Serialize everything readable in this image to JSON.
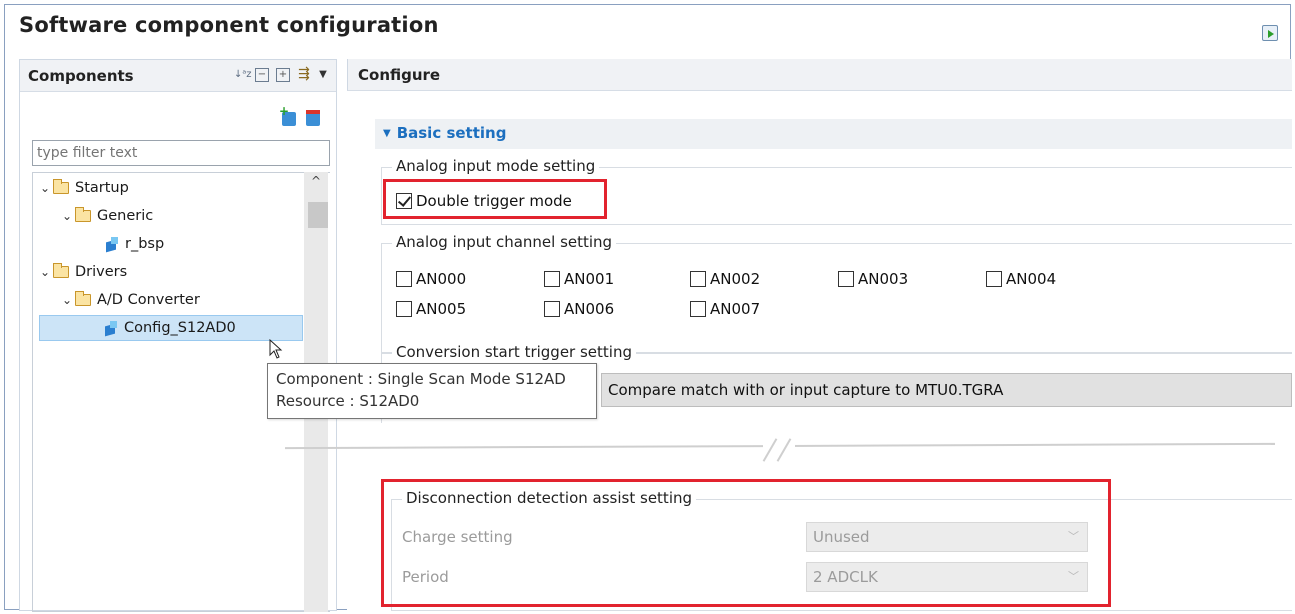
{
  "window": {
    "title": "Software component configuration"
  },
  "components_pane": {
    "title": "Components",
    "filter": {
      "placeholder": "type filter text",
      "value": ""
    },
    "tree": [
      {
        "label": "Startup",
        "level": 0,
        "type": "folder",
        "expanded": true
      },
      {
        "label": "Generic",
        "level": 1,
        "type": "folder",
        "expanded": true
      },
      {
        "label": "r_bsp",
        "level": 2,
        "type": "component"
      },
      {
        "label": "Drivers",
        "level": 0,
        "type": "folder",
        "expanded": true
      },
      {
        "label": "A/D Converter",
        "level": 1,
        "type": "folder",
        "expanded": true
      },
      {
        "label": "Config_S12AD0",
        "level": 2,
        "type": "component",
        "selected": true
      }
    ],
    "tooltip": {
      "component": "Component : Single Scan Mode S12AD",
      "resource": "Resource : S12AD0"
    }
  },
  "configure_pane": {
    "title": "Configure",
    "section": "Basic setting",
    "analog_input_mode": {
      "label": "Analog input mode setting",
      "double_trigger": {
        "label": "Double trigger mode",
        "checked": true
      }
    },
    "analog_input_channel": {
      "label": "Analog input channel setting",
      "channels": [
        "AN000",
        "AN001",
        "AN002",
        "AN003",
        "AN004",
        "AN005",
        "AN006",
        "AN007"
      ]
    },
    "conversion_start": {
      "label": "Conversion start trigger setting",
      "value": "Compare match with or input capture to MTU0.TGRA"
    },
    "disconnection": {
      "label": "Disconnection detection assist setting",
      "charge_label": "Charge setting",
      "charge_value": "Unused",
      "period_label": "Period",
      "period_value": "2 ADCLK"
    }
  },
  "colors": {
    "highlight": "#e2232e",
    "section_title": "#1c6fbf",
    "selection": "#cce4f7"
  }
}
